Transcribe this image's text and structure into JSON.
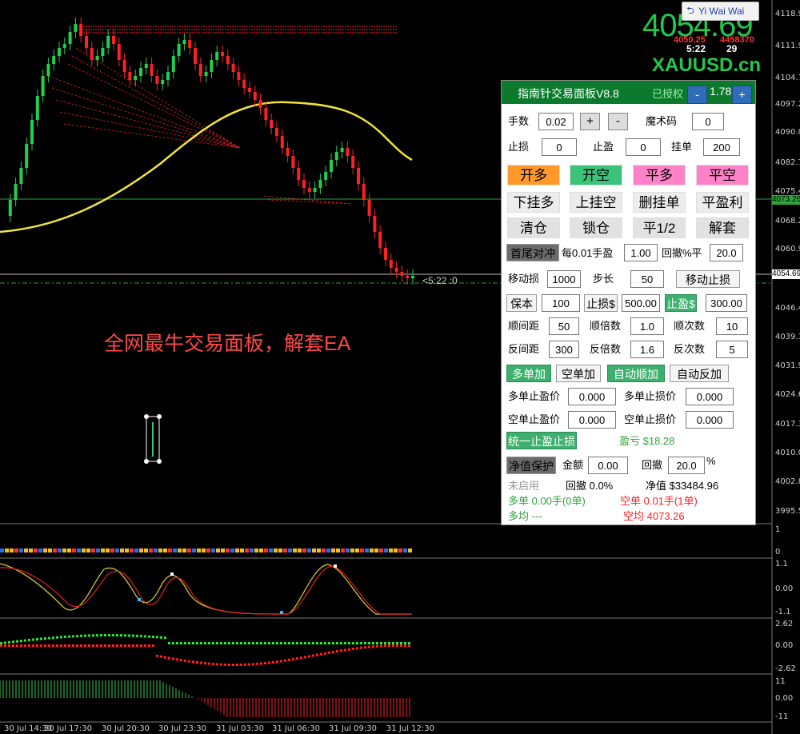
{
  "user": {
    "name": "Yi Wai Wai"
  },
  "quote": {
    "price": "4054.69",
    "bid_left": "4050.25",
    "bid_right": "4458370",
    "timer": "5:22",
    "timer_right": "29",
    "symbol": "XAUUSD.cn",
    "current_price_label": "4054.69",
    "line_price_label": "4073.26",
    "chart_timer": "<5:22 :0"
  },
  "overlay_text": "全网最牛交易面板，解套EA",
  "price_axis": [
    "4118.90",
    "4111.90",
    "4104.75",
    "4097.25",
    "4090.05",
    "4082.75",
    "4075.40",
    "4068.25",
    "4060.95",
    "4054.60",
    "4046.45",
    "4039.15",
    "4031.95",
    "4024.60",
    "4017.35",
    "4010.05",
    "4002.80",
    "3995.55"
  ],
  "price_top_partial": "4118.90",
  "time_axis": [
    "30 Jul 14:30",
    "30 Jul 17:30",
    "30 Jul 20:30",
    "30 Jul 23:30",
    "31 Jul 03:30",
    "31 Jul 06:30",
    "31 Jul 09:30",
    "31 Jul 12:30"
  ],
  "sub1_axis": [
    "1",
    "0"
  ],
  "sub2_axis": [
    "1.1",
    "0.00",
    "-1.1"
  ],
  "sub3_axis": [
    "2.62",
    "0.00",
    "-2.62"
  ],
  "sub4_axis": [
    "11",
    "0.00",
    "-11"
  ],
  "panel": {
    "title": "指南针交易面板V8.8",
    "auth": "已授权",
    "version": "1.78",
    "minus": "-",
    "plus": "+",
    "lot_label": "手数",
    "lot_value": "0.02",
    "lot_plus": "+",
    "lot_minus": "-",
    "magic_label": "魔术码",
    "magic_value": "0",
    "sl_label": "止损",
    "sl_value": "0",
    "tp_label": "止盈",
    "tp_value": "0",
    "pending_label": "挂单",
    "pending_value": "200",
    "btn_open_long": "开多",
    "btn_open_short": "开空",
    "btn_close_long": "平多",
    "btn_close_short": "平空",
    "btn_pending_long": "下挂多",
    "btn_pending_short": "上挂空",
    "btn_delete_pending": "删挂单",
    "btn_close_profit": "平盈利",
    "btn_clear": "清仓",
    "btn_lock": "锁仓",
    "btn_half": "平1/2",
    "btn_unlock": "解套",
    "hedge_btn": "首尾对冲",
    "per_lot_label": "每0.01手盈",
    "per_lot_value": "1.00",
    "drawdown_pct_label": "回撤%平",
    "drawdown_pct_value": "20.0",
    "trail_label": "移动损",
    "trail_value": "1000",
    "step_label": "步长",
    "step_value": "50",
    "trail_btn": "移动止损",
    "be_btn": "保本",
    "be_value": "100",
    "sl_usd_btn": "止损$",
    "sl_usd_value": "500.00",
    "tp_usd_btn": "止盈$",
    "tp_usd_value": "300.00",
    "fwd_gap_label": "顺间距",
    "fwd_gap_value": "50",
    "fwd_mult_label": "顺倍数",
    "fwd_mult_value": "1.0",
    "fwd_count_label": "顺次数",
    "fwd_count_value": "10",
    "rev_gap_label": "反间距",
    "rev_gap_value": "300",
    "rev_mult_label": "反倍数",
    "rev_mult_value": "1.6",
    "rev_count_label": "反次数",
    "rev_count_value": "5",
    "btn_long_add": "多单加",
    "btn_short_add": "空单加",
    "btn_auto_fwd": "自动顺加",
    "btn_auto_rev": "自动反加",
    "long_tp_label": "多单止盈价",
    "long_tp_value": "0.000",
    "long_sl_label": "多单止损价",
    "long_sl_value": "0.000",
    "short_tp_label": "空单止盈价",
    "short_tp_value": "0.000",
    "short_sl_label": "空单止损价",
    "short_sl_value": "0.000",
    "unified_btn": "统一止盈止损价",
    "pnl_label": "盈亏 $18.28",
    "equity_btn": "净值保护",
    "amount_label": "金额",
    "amount_value": "0.00",
    "retrace_label": "回撤",
    "retrace_value": "20.0",
    "retrace_unit": "%",
    "not_enabled": "未启用",
    "retrace_info": "回撤 0.0%",
    "equity_info": "净值 $33484.96",
    "long_info": "多单 0.00手(0单)",
    "short_info": "空单 0.01手(1单)",
    "long_avg": "多均 ---",
    "short_avg": "空均 4073.26"
  }
}
